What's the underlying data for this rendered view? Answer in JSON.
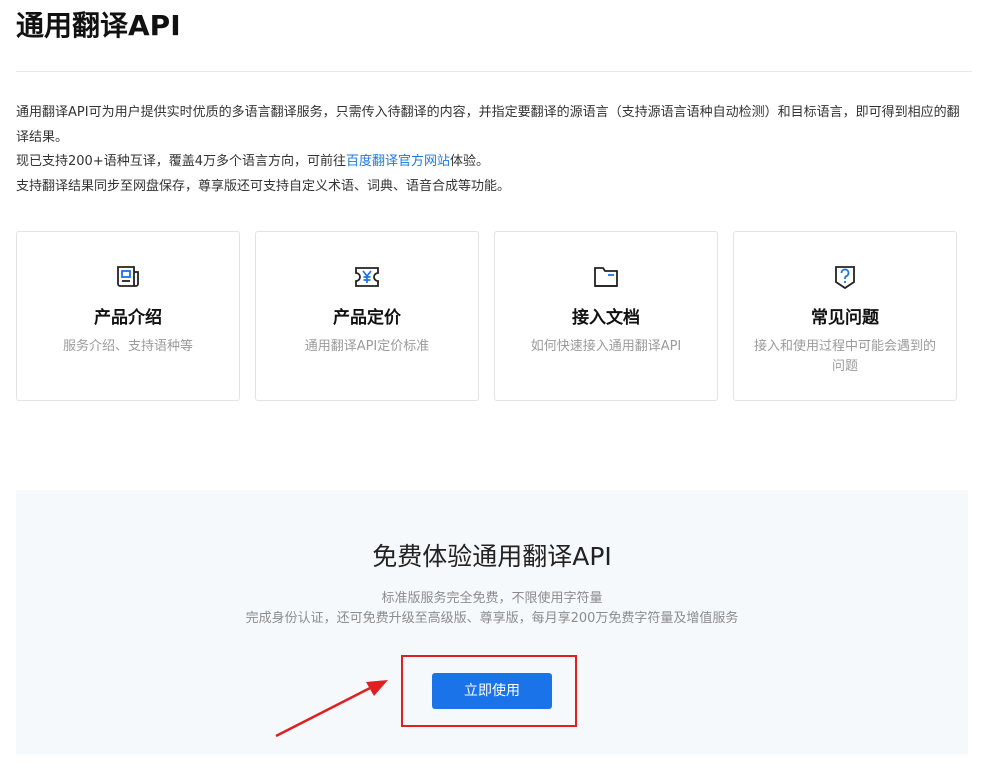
{
  "page": {
    "title": "通用翻译API"
  },
  "intro": {
    "line1": "通用翻译API可为用户提供实时优质的多语言翻译服务，只需传入待翻译的内容，并指定要翻译的源语言（支持源语言语种自动检测）和目标语言，即可得到相应的翻译结果。",
    "line2_prefix": "现已支持200+语种互译，覆盖4万多个语言方向，可前往",
    "line2_link": "百度翻译官方网站",
    "line2_suffix": "体验。",
    "line3": "支持翻译结果同步至网盘保存，尊享版还可支持自定义术语、词典、语音合成等功能。"
  },
  "cards": [
    {
      "title": "产品介绍",
      "desc": "服务介绍、支持语种等",
      "icon": "newspaper-icon"
    },
    {
      "title": "产品定价",
      "desc": "通用翻译API定价标准",
      "icon": "yen-ticket-icon"
    },
    {
      "title": "接入文档",
      "desc": "如何快速接入通用翻译API",
      "icon": "folder-icon"
    },
    {
      "title": "常见问题",
      "desc": "接入和使用过程中可能会遇到的问题",
      "icon": "question-shield-icon"
    }
  ],
  "cta": {
    "title": "免费体验通用翻译API",
    "desc1": "标准版服务完全免费，不限使用字符量",
    "desc2": "完成身份认证，还可免费升级至高级版、尊享版，每月享200万免费字符量及增值服务",
    "button_label": "立即使用"
  },
  "colors": {
    "accent": "#1a73e8",
    "link": "#1f7ae0",
    "annotation": "#e02020",
    "cta_background": "#f5f9fc"
  }
}
